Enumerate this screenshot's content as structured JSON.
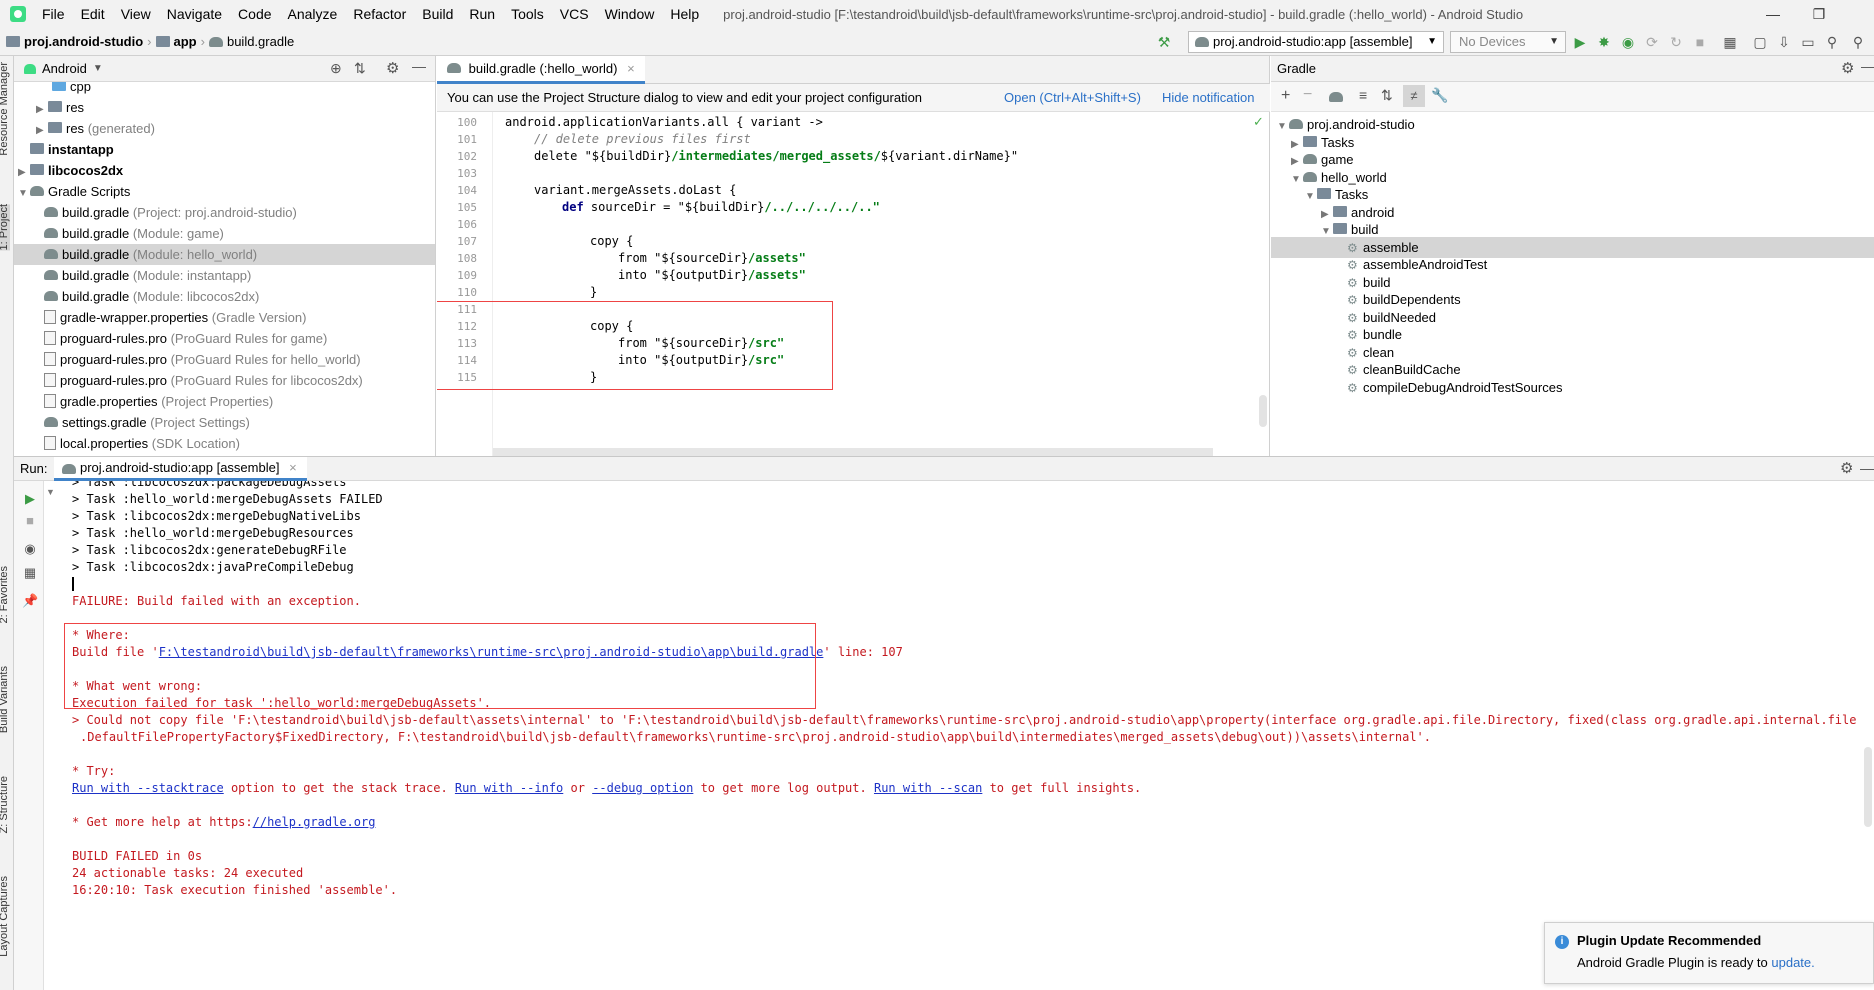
{
  "menubar": {
    "items": [
      "File",
      "Edit",
      "View",
      "Navigate",
      "Code",
      "Analyze",
      "Refactor",
      "Build",
      "Run",
      "Tools",
      "VCS",
      "Window",
      "Help"
    ],
    "window_title": "proj.android-studio [F:\\testandroid\\build\\jsb-default\\frameworks\\runtime-src\\proj.android-studio] - build.gradle (:hello_world) - Android Studio"
  },
  "navbar": {
    "crumbs": [
      "proj.android-studio",
      "app",
      "build.gradle"
    ],
    "run_config": "proj.android-studio:app [assemble]",
    "devices": "No Devices"
  },
  "left_strip": {
    "tabs": [
      "Resource Manager",
      "1: Project",
      "2: Favorites",
      "Build Variants",
      "Z: Structure",
      "Layout Captures"
    ]
  },
  "project_panel": {
    "view_selector": "Android",
    "rows": [
      {
        "label": "cpp",
        "note": ""
      },
      {
        "label": "res",
        "note": ""
      },
      {
        "label": "res",
        "note": "(generated)"
      },
      {
        "label": "instantapp",
        "note": ""
      },
      {
        "label": "libcocos2dx",
        "note": ""
      },
      {
        "label": "Gradle Scripts",
        "note": ""
      },
      {
        "label": "build.gradle",
        "note": "(Project: proj.android-studio)"
      },
      {
        "label": "build.gradle",
        "note": "(Module: game)"
      },
      {
        "label": "build.gradle",
        "note": "(Module: hello_world)"
      },
      {
        "label": "build.gradle",
        "note": "(Module: instantapp)"
      },
      {
        "label": "build.gradle",
        "note": "(Module: libcocos2dx)"
      },
      {
        "label": "gradle-wrapper.properties",
        "note": "(Gradle Version)"
      },
      {
        "label": "proguard-rules.pro",
        "note": "(ProGuard Rules for game)"
      },
      {
        "label": "proguard-rules.pro",
        "note": "(ProGuard Rules for hello_world)"
      },
      {
        "label": "proguard-rules.pro",
        "note": "(ProGuard Rules for libcocos2dx)"
      },
      {
        "label": "gradle.properties",
        "note": "(Project Properties)"
      },
      {
        "label": "settings.gradle",
        "note": "(Project Settings)"
      },
      {
        "label": "local.properties",
        "note": "(SDK Location)"
      }
    ]
  },
  "editor": {
    "tab_label": "build.gradle (:hello_world)",
    "notification": "You can use the Project Structure dialog to view and edit your project configuration",
    "notif_open": "Open (Ctrl+Alt+Shift+S)",
    "notif_hide": "Hide notification",
    "line_numbers": [
      "100",
      "101",
      "102",
      "103",
      "104",
      "105",
      "106",
      "107",
      "108",
      "109",
      "110",
      "111",
      "112",
      "113",
      "114",
      "115"
    ],
    "code": {
      "l100": "android.applicationVariants.all { variant ->",
      "l101": "// delete previous files first",
      "l102a": "delete ",
      "l102b": "\"${buildDir}",
      "l102c": "/intermediates/merged_assets/",
      "l102d": "${variant.dirName}\"",
      "l104": "variant.mergeAssets.doLast {",
      "l105a": "def",
      "l105b": " sourceDir = ",
      "l105c": "\"${buildDir}",
      "l105d": "/../../../../..\"",
      "l107": "copy {",
      "l108a": "from ",
      "l108b": "\"${sourceDir}",
      "l108c": "/assets\"",
      "l109a": "into ",
      "l109b": "\"${outputDir}",
      "l109c": "/assets\"",
      "l110": "}",
      "l112": "copy {",
      "l113a": "from ",
      "l113b": "\"${sourceDir}",
      "l113c": "/src\"",
      "l114a": "into ",
      "l114b": "\"${outputDir}",
      "l114c": "/src\"",
      "l115": "}"
    }
  },
  "gradle_panel": {
    "title": "Gradle",
    "rows": [
      {
        "label": "proj.android-studio"
      },
      {
        "label": "Tasks"
      },
      {
        "label": "game"
      },
      {
        "label": "hello_world"
      },
      {
        "label": "Tasks"
      },
      {
        "label": "android"
      },
      {
        "label": "build"
      },
      {
        "label": "assemble"
      },
      {
        "label": "assembleAndroidTest"
      },
      {
        "label": "build"
      },
      {
        "label": "buildDependents"
      },
      {
        "label": "buildNeeded"
      },
      {
        "label": "bundle"
      },
      {
        "label": "clean"
      },
      {
        "label": "cleanBuildCache"
      },
      {
        "label": "compileDebugAndroidTestSources"
      }
    ]
  },
  "run_panel": {
    "label": "Run:",
    "tab": "proj.android-studio:app [assemble]",
    "lines": {
      "t1": "> Task :libcocos2dx:packageDebugAssets",
      "t2": "> Task :hello_world:mergeDebugAssets FAILED",
      "t3": "> Task :libcocos2dx:mergeDebugNativeLibs",
      "t4": "> Task :hello_world:mergeDebugResources",
      "t5": "> Task :libcocos2dx:generateDebugRFile",
      "t6": "> Task :libcocos2dx:javaPreCompileDebug",
      "failure": "FAILURE: Build failed with an exception.",
      "where": "* Where:",
      "build_file_pre": "Build file '",
      "build_file_link": "F:\\testandroid\\build\\jsb-default\\frameworks\\runtime-src\\proj.android-studio\\app\\build.gradle",
      "build_file_post": "' line: 107",
      "wrong": "* What went wrong:",
      "exec_failed": "Execution failed for task ':hello_world:mergeDebugAssets'.",
      "could_not_1": "> Could not copy file 'F:\\testandroid\\build\\jsb-default\\assets\\internal' to 'F:\\testandroid\\build\\jsb-default\\frameworks\\runtime-src\\proj.android-studio\\app\\property(interface org.gradle.api.file.Directory, fixed(class org.gradle.api.internal.file",
      "could_not_2": ".DefaultFilePropertyFactory$FixedDirectory, F:\\testandroid\\build\\jsb-default\\frameworks\\runtime-src\\proj.android-studio\\app\\build\\intermediates\\merged_assets\\debug\\out))\\assets\\internal'.",
      "try": "* Try:",
      "run_stack": "Run with --stacktrace",
      "try_t1": " option to get the stack trace. ",
      "run_info": "Run with --info",
      "try_or": " or ",
      "run_debug": "--debug option",
      "try_t2": " to get more log output. ",
      "run_scan": "Run with --scan",
      "try_t3": " to get full insights.",
      "help_pre": "* Get more help at https:",
      "help_link": "//help.gradle.org",
      "build_failed": "BUILD FAILED in 0s",
      "tasks": "24 actionable tasks: 24 executed",
      "finished": "16:20:10: Task execution finished 'assemble'."
    }
  },
  "popup": {
    "title": "Plugin Update Recommended",
    "body": "Android Gradle Plugin is ready to ",
    "link": "update."
  }
}
